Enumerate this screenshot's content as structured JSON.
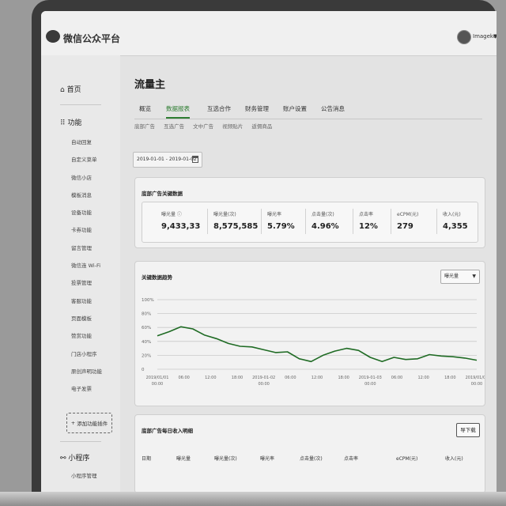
{
  "app": {
    "name": "微信公众平台",
    "username": "Imagekey"
  },
  "sidebar": {
    "home": "首页",
    "functions": "功能",
    "items": [
      "自动回复",
      "自定义菜单",
      "微信小店",
      "模板消息",
      "设备功能",
      "卡券功能",
      "留言管理",
      "微信连 Wi-Fi",
      "投票管理",
      "客服功能",
      "页面模板",
      "赞赏功能",
      "门店小程序",
      "原创声明功能",
      "电子发票"
    ],
    "add_plugin": "添加功能插件",
    "mini_program": "小程序",
    "mini_program_sub": "小程序管理"
  },
  "page": {
    "title": "流量主",
    "tabs": [
      "概览",
      "数据报表",
      "互选合作",
      "财务管理",
      "账户设置",
      "公告消息"
    ],
    "active_tab": 1,
    "subtabs": [
      "底部广告",
      "互选广告",
      "文中广告",
      "视频贴片",
      "返佣商品"
    ],
    "date_range": "2019-01-01 - 2019-01-02"
  },
  "kpi": {
    "title": "底部广告关键数据",
    "items": [
      {
        "label": "曝光量 ⓘ",
        "value": "9,433,33"
      },
      {
        "label": "曝光量(次)",
        "value": "8,575,585"
      },
      {
        "label": "曝光率",
        "value": "5.79%"
      },
      {
        "label": "点击量(次)",
        "value": "4.96%"
      },
      {
        "label": "点击率",
        "value": "12%"
      },
      {
        "label": "eCPM(元)",
        "value": "279"
      },
      {
        "label": "收入(元)",
        "value": "4,355"
      }
    ]
  },
  "trend": {
    "title": "关键数据趋势",
    "select": "曝光量"
  },
  "chart_data": {
    "type": "line",
    "title": "关键数据趋势",
    "ylim": [
      0,
      100
    ],
    "grid": true,
    "y_ticks": [
      "100%",
      "80%",
      "60%",
      "40%",
      "20%",
      "0"
    ],
    "x_ticks": [
      [
        "2019/01/01",
        "00:00"
      ],
      [
        "06:00"
      ],
      [
        "12:00"
      ],
      [
        "18:00"
      ],
      [
        "2019-01-02",
        "00:00"
      ],
      [
        "06:00"
      ],
      [
        "12:00"
      ],
      [
        "18:00"
      ],
      [
        "2019-01-03",
        "00:00"
      ],
      [
        "06:00"
      ],
      [
        "12:00"
      ],
      [
        "18:00"
      ],
      [
        "2019/01/04",
        "00:00"
      ]
    ],
    "series": [
      {
        "values": [
          48,
          54,
          61,
          58,
          49,
          44,
          37,
          33,
          32,
          28,
          24,
          25,
          15,
          11,
          20,
          26,
          30,
          27,
          17,
          11,
          17,
          14,
          15,
          21,
          19,
          18,
          16,
          13
        ]
      }
    ]
  },
  "table": {
    "title": "底部广告每日收入明细",
    "export_label": "导下载",
    "headers": [
      "日期",
      "曝光量",
      "曝光量(次)",
      "曝光率",
      "点击量(次)",
      "点击率",
      "eCPM(元)",
      "收入(元)"
    ]
  },
  "colors": {
    "accent": "#2e7d32",
    "line": "#1f6b24"
  }
}
